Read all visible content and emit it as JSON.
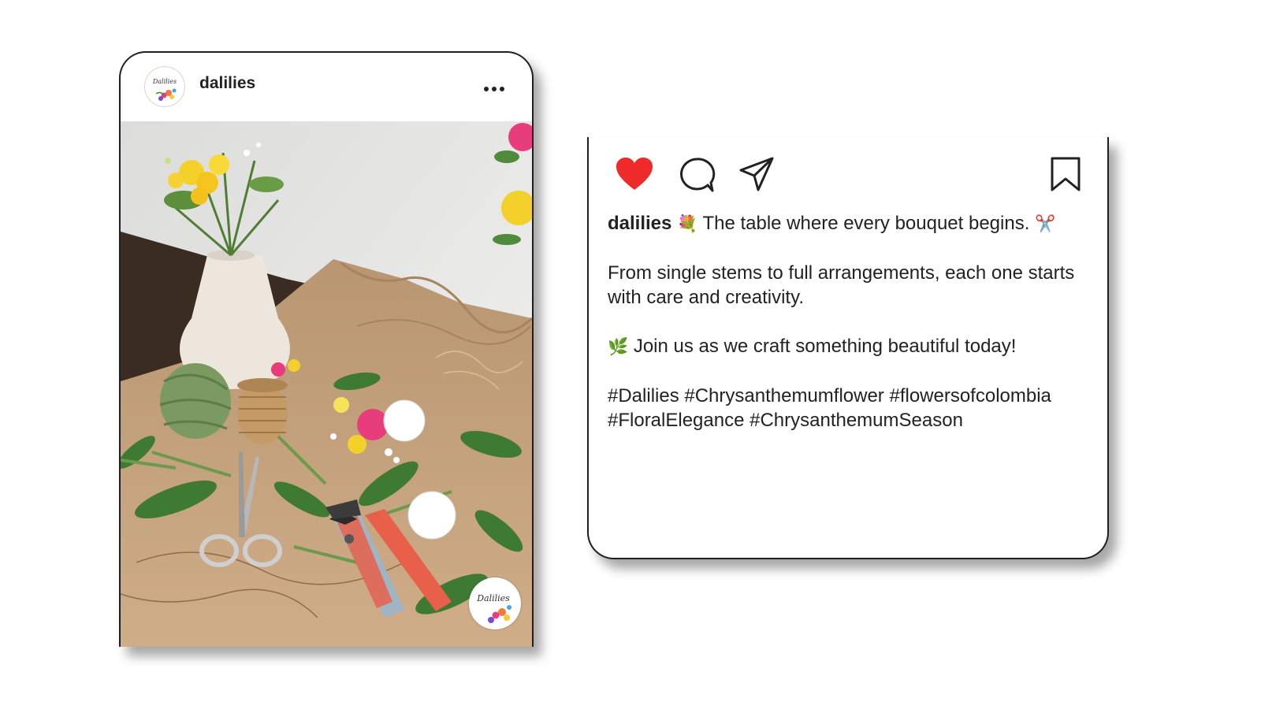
{
  "post": {
    "username": "dalilies",
    "avatar_text": "Dalilies",
    "watermark_text": "Dalilies",
    "more_icon": "more-horizontal-icon"
  },
  "actions": {
    "like_icon": "heart-filled-icon",
    "like_color": "#ee2a2a",
    "comment_icon": "comment-icon",
    "share_icon": "send-icon",
    "save_icon": "bookmark-icon"
  },
  "caption": {
    "username": "dalilies",
    "emoji_bouquet": "💐",
    "line1": "The table where every bouquet begins.",
    "emoji_scissors": "✂️",
    "paragraph2": "From single stems to full arrangements, each one starts with care and creativity.",
    "emoji_herb": "🌿",
    "paragraph3": "Join us as we craft something beautiful today!",
    "hashtags_line1": "#Dalilies #Chrysanthemumflower #flowersofcolombia",
    "hashtags_line2": "#FloralElegance #ChrysanthemumSeason"
  }
}
